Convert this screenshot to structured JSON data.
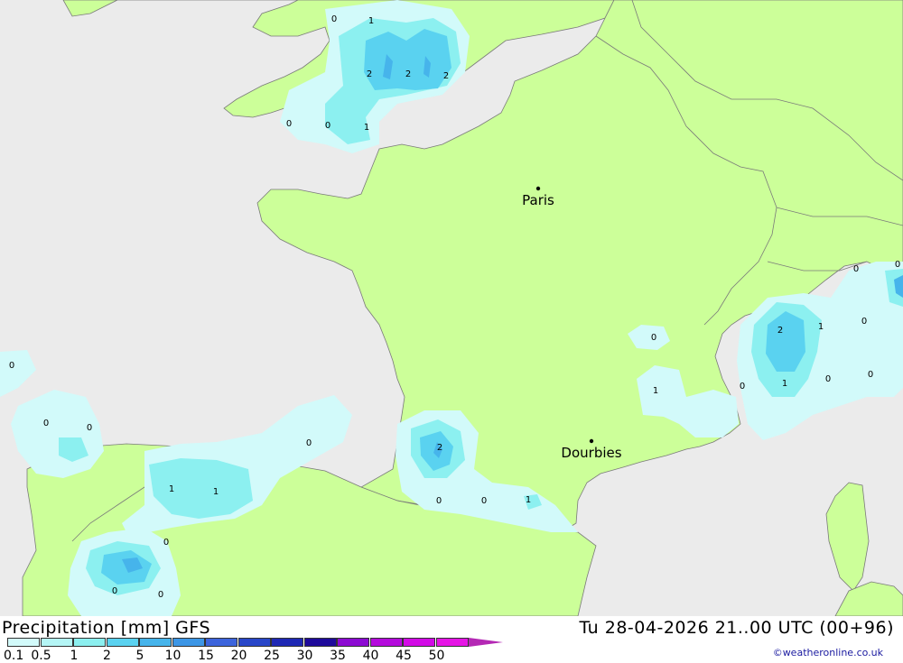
{
  "header": {
    "title": "Precipitation [mm] GFS",
    "datetime": "Tu 28-04-2026 21..00 UTC (00+96)",
    "credit": "©weatheronline.co.uk"
  },
  "colors": {
    "sea": "#ebebeb",
    "land": "#ccff99",
    "border": "#7a7a7a"
  },
  "legend": {
    "labels": [
      "0.1",
      "0.5",
      "1",
      "2",
      "5",
      "10",
      "15",
      "20",
      "25",
      "30",
      "35",
      "40",
      "45",
      "50"
    ],
    "colors": [
      "#d2fafa",
      "#b4f5f5",
      "#8cf0f0",
      "#5ad2f0",
      "#46b4eb",
      "#3c96e6",
      "#3c64dc",
      "#2846c8",
      "#1e28b4",
      "#1e0a9b",
      "#8c0ad2",
      "#b40adc",
      "#d20ae6",
      "#e614e6",
      "#b428b4"
    ]
  },
  "cities": [
    {
      "name": "Paris"
    },
    {
      "name": "Dourbies"
    }
  ],
  "values": [
    "0",
    "1",
    "2",
    "2",
    "2",
    "0",
    "0",
    "1",
    "0",
    "0",
    "0",
    "0",
    "1",
    "1",
    "0",
    "0",
    "0",
    "2",
    "0",
    "0",
    "1",
    "0",
    "1",
    "2",
    "1",
    "0",
    "0",
    "1",
    "0",
    "0",
    "0",
    "0"
  ]
}
